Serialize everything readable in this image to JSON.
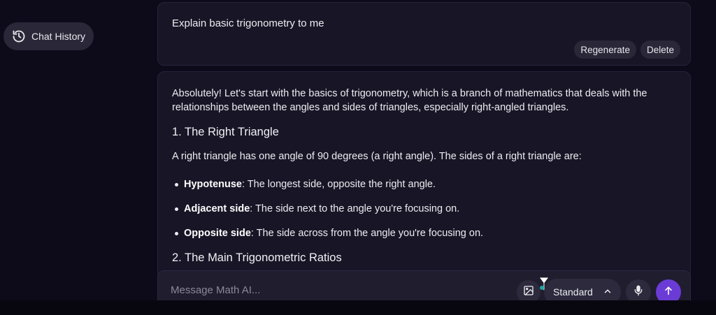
{
  "sidebar": {
    "history_label": "Chat History",
    "history_icon": "history-icon"
  },
  "user_message": {
    "text": "Explain basic trigonometry to me",
    "actions": [
      "Regenerate",
      "Delete"
    ]
  },
  "assistant_message": {
    "intro": "Absolutely! Let's start with the basics of trigonometry, which is a branch of mathematics that deals with the relationships between the angles and sides of triangles, especially right-angled triangles.",
    "heading1": "1. The Right Triangle",
    "desc": "A right triangle has one angle of 90 degrees (a right angle). The sides of a right triangle are:",
    "bullets": [
      {
        "term": "Hypotenuse",
        "text": ": The longest side, opposite the right angle."
      },
      {
        "term": "Adjacent side",
        "text": ": The side next to the angle you're focusing on."
      },
      {
        "term": "Opposite side",
        "text": ": The side across from the angle you're focusing on."
      }
    ],
    "heading2": "2. The Main Trigonometric Ratios"
  },
  "composer": {
    "placeholder": "Message Math AI...",
    "model": "Standard",
    "icons": [
      "image-icon",
      "chevron-up-icon",
      "microphone-icon",
      "arrow-up-icon"
    ]
  },
  "colors": {
    "background": "#0d0b1a",
    "card": "#181626",
    "pill": "#2a2838",
    "send": "#6b3bd6"
  }
}
